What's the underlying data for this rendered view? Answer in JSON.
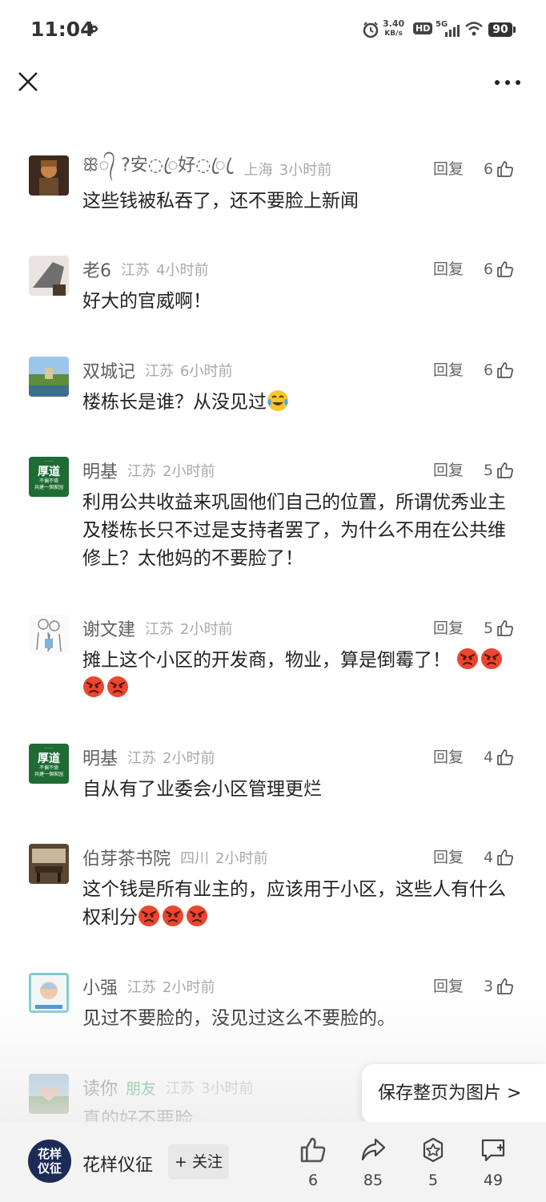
{
  "status_bar": {
    "time": "11:04",
    "speed": "3.40",
    "speed_unit": "KB/s",
    "hd": "HD",
    "net": "5G",
    "battery": "90"
  },
  "comments": [
    {
      "name": "ꕥ᭄ ?安◌ꦿ好◌ꦿ ꦿ",
      "location": "上海",
      "time": "3小时前",
      "reply": "回复",
      "likes": "6",
      "text": "这些钱被私吞了，还不要脸上新闻",
      "emojis": []
    },
    {
      "name": "老6",
      "location": "江苏",
      "time": "4小时前",
      "reply": "回复",
      "likes": "6",
      "text": "好大的官威啊！",
      "emojis": []
    },
    {
      "name": "双城记",
      "location": "江苏",
      "time": "6小时前",
      "reply": "回复",
      "likes": "6",
      "text": "楼栋长是谁？从没见过",
      "emojis": [
        "laugh-cry"
      ]
    },
    {
      "name": "明基",
      "location": "江苏",
      "time": "2小时前",
      "reply": "回复",
      "likes": "5",
      "text": "利用公共收益来巩固他们自己的位置，所谓优秀业主及楼栋长只不过是支持者罢了，为什么不用在公共维修上？太他妈的不要脸了！",
      "emojis": []
    },
    {
      "name": "谢文建",
      "location": "江苏",
      "time": "2小时前",
      "reply": "回复",
      "likes": "5",
      "text": "摊上这个小区的开发商，物业，算是倒霉了！",
      "emojis": [
        "angry",
        "angry",
        "angry",
        "angry"
      ]
    },
    {
      "name": "明基",
      "location": "江苏",
      "time": "2小时前",
      "reply": "回复",
      "likes": "4",
      "text": "自从有了业委会小区管理更烂",
      "emojis": []
    },
    {
      "name": "伯芽茶书院",
      "location": "四川",
      "time": "2小时前",
      "reply": "回复",
      "likes": "4",
      "text": "这个钱是所有业主的，应该用于小区，这些人有什么权利分",
      "emojis": [
        "angry",
        "angry",
        "angry"
      ]
    },
    {
      "name": "小强",
      "location": "江苏",
      "time": "2小时前",
      "reply": "回复",
      "likes": "3",
      "text": "见过不要脸的，没见过这么不要脸的。",
      "emojis": []
    },
    {
      "name": "读你",
      "friend": "朋友",
      "location": "江苏",
      "time": "3小时前",
      "text": "真的好不要脸",
      "emojis": []
    }
  ],
  "avatars": {
    "a0_text_1": "",
    "mingji_line1": "厚道",
    "mingji_line2": "不偏不倚",
    "mingji_line3": "共建一個家园"
  },
  "save_page": {
    "label": "保存整页为图片 >"
  },
  "bottom": {
    "logo_text_1": "花样",
    "logo_text_2": "仪征",
    "channel_name": "花样仪征",
    "follow_label": "+ 关注",
    "like_count": "6",
    "share_count": "85",
    "collect_count": "5",
    "comment_count": "49"
  },
  "colors": {
    "friend": "#1a9f4a",
    "logo_bg": "#1d2b57",
    "avatar_green": "#1e6b34"
  }
}
